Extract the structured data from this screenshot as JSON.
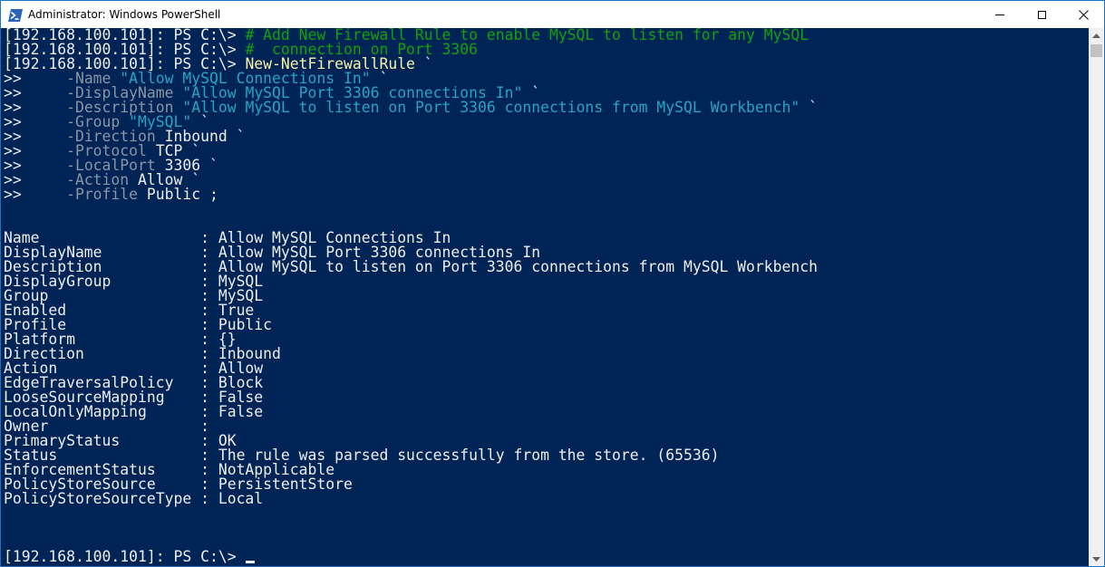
{
  "window": {
    "title": "Administrator: Windows PowerShell",
    "icon": "powershell-icon",
    "controls": [
      "minimize-icon",
      "maximize-icon",
      "close-icon"
    ]
  },
  "colors": {
    "background": "#012456",
    "text": "#eeedf0",
    "comment": "#13a10e",
    "command": "#f9f1a5",
    "parameter": "#8a95a5",
    "string": "#2aa3c2"
  },
  "console": {
    "lines": [
      [
        [
          "norm",
          "[192.168.100.101]: PS C:\\> "
        ],
        [
          "comment",
          "# Add New Firewall Rule to enable MySQL to listen for any MySQL"
        ]
      ],
      [
        [
          "norm",
          "[192.168.100.101]: PS C:\\> "
        ],
        [
          "comment",
          "#  connection on Port 3306"
        ]
      ],
      [
        [
          "norm",
          "[192.168.100.101]: PS C:\\> "
        ],
        [
          "cmd",
          "New-NetFirewallRule"
        ],
        [
          "norm",
          " `"
        ]
      ],
      [
        [
          "norm",
          ">>     "
        ],
        [
          "param",
          "-Name"
        ],
        [
          "norm",
          " "
        ],
        [
          "str",
          "\"Allow MySQL Connections In\""
        ],
        [
          "norm",
          " `"
        ]
      ],
      [
        [
          "norm",
          ">>     "
        ],
        [
          "param",
          "-DisplayName"
        ],
        [
          "norm",
          " "
        ],
        [
          "str",
          "\"Allow MySQL Port 3306 connections In\""
        ],
        [
          "norm",
          " `"
        ]
      ],
      [
        [
          "norm",
          ">>     "
        ],
        [
          "param",
          "-Description"
        ],
        [
          "norm",
          " "
        ],
        [
          "str",
          "\"Allow MySQL to listen on Port 3306 connections from MySQL Workbench\""
        ],
        [
          "norm",
          " `"
        ]
      ],
      [
        [
          "norm",
          ">>     "
        ],
        [
          "param",
          "-Group"
        ],
        [
          "norm",
          " "
        ],
        [
          "str",
          "\"MySQL\""
        ],
        [
          "norm",
          " `"
        ]
      ],
      [
        [
          "norm",
          ">>     "
        ],
        [
          "param",
          "-Direction"
        ],
        [
          "norm",
          " Inbound `"
        ]
      ],
      [
        [
          "norm",
          ">>     "
        ],
        [
          "param",
          "-Protocol"
        ],
        [
          "norm",
          " TCP `"
        ]
      ],
      [
        [
          "norm",
          ">>     "
        ],
        [
          "param",
          "-LocalPort"
        ],
        [
          "norm",
          " 3306 `"
        ]
      ],
      [
        [
          "norm",
          ">>     "
        ],
        [
          "param",
          "-Action"
        ],
        [
          "norm",
          " Allow `"
        ]
      ],
      [
        [
          "norm",
          ">>     "
        ],
        [
          "param",
          "-Profile"
        ],
        [
          "norm",
          " Public ;"
        ]
      ],
      [],
      [],
      [
        [
          "norm",
          "Name                  : Allow MySQL Connections In"
        ]
      ],
      [
        [
          "norm",
          "DisplayName           : Allow MySQL Port 3306 connections In"
        ]
      ],
      [
        [
          "norm",
          "Description           : Allow MySQL to listen on Port 3306 connections from MySQL Workbench"
        ]
      ],
      [
        [
          "norm",
          "DisplayGroup          : MySQL"
        ]
      ],
      [
        [
          "norm",
          "Group                 : MySQL"
        ]
      ],
      [
        [
          "norm",
          "Enabled               : True"
        ]
      ],
      [
        [
          "norm",
          "Profile               : Public"
        ]
      ],
      [
        [
          "norm",
          "Platform              : {}"
        ]
      ],
      [
        [
          "norm",
          "Direction             : Inbound"
        ]
      ],
      [
        [
          "norm",
          "Action                : Allow"
        ]
      ],
      [
        [
          "norm",
          "EdgeTraversalPolicy   : Block"
        ]
      ],
      [
        [
          "norm",
          "LooseSourceMapping    : False"
        ]
      ],
      [
        [
          "norm",
          "LocalOnlyMapping      : False"
        ]
      ],
      [
        [
          "norm",
          "Owner                 :"
        ]
      ],
      [
        [
          "norm",
          "PrimaryStatus         : OK"
        ]
      ],
      [
        [
          "norm",
          "Status                : The rule was parsed successfully from the store. (65536)"
        ]
      ],
      [
        [
          "norm",
          "EnforcementStatus     : NotApplicable"
        ]
      ],
      [
        [
          "norm",
          "PolicyStoreSource     : PersistentStore"
        ]
      ],
      [
        [
          "norm",
          "PolicyStoreSourceType : Local"
        ]
      ],
      [],
      [],
      [],
      [
        [
          "norm",
          "[192.168.100.101]: PS C:\\> "
        ],
        [
          "cursor",
          ""
        ]
      ]
    ]
  }
}
